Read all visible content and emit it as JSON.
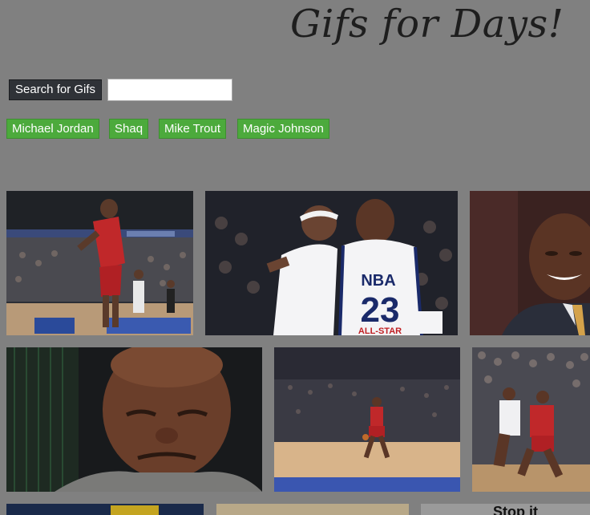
{
  "header": {
    "title": "Gifs for Days!"
  },
  "search": {
    "button_label": "Search for Gifs",
    "input_value": "",
    "placeholder": ""
  },
  "topics": [
    "Michael Jordan",
    "Shaq",
    "Mike Trout",
    "Magic Johnson"
  ],
  "gifs": [
    {
      "name": "jordan-dunk-arena",
      "subject": "basketball player in red jersey on court"
    },
    {
      "name": "iverson-jordan-allstar",
      "subject": "two all-star players facing each other",
      "jersey_text": "NBA",
      "jersey_number": "23",
      "jersey_sub": "ALL-STAR"
    },
    {
      "name": "jordan-laughing",
      "subject": "man laughing in suit"
    },
    {
      "name": "crying-jordan",
      "subject": "crying man close-up"
    },
    {
      "name": "jordan-dribble-court",
      "subject": "player dribbling on court"
    },
    {
      "name": "jordan-drive-crowd",
      "subject": "players driving toward basket"
    }
  ],
  "partial_caption": "Stop it",
  "colors": {
    "background": "#808080",
    "topic_button": "#4caa3c",
    "search_button": "#2f3237"
  }
}
